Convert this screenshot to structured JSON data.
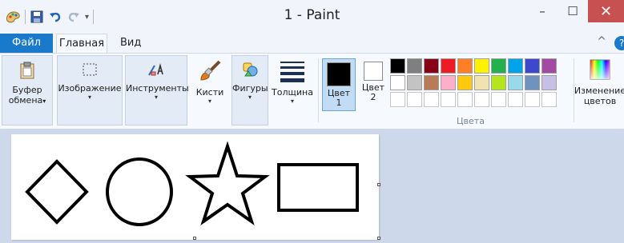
{
  "window": {
    "title": "1 - Paint",
    "minimize": "–",
    "maximize": "☐",
    "close": "✕"
  },
  "tabs": {
    "file": "Файл",
    "home": "Главная",
    "view": "Вид",
    "collapse": "^",
    "help": "?"
  },
  "ribbon": {
    "clipboard": {
      "line1": "Буфер",
      "line2": "обмена",
      "arrow": "▾"
    },
    "image": {
      "label": "Изображение",
      "arrow": "▾"
    },
    "tools": {
      "label": "Инструменты",
      "arrow": "▾"
    },
    "brushes": {
      "label": "Кисти",
      "arrow": "▾"
    },
    "shapes": {
      "label": "Фигуры",
      "arrow": "▾"
    },
    "thickness": {
      "label": "Толщина",
      "arrow": "▾"
    },
    "color1": {
      "line1": "Цвет",
      "line2": "1",
      "color": "#000000"
    },
    "color2": {
      "line1": "Цвет",
      "line2": "2",
      "color": "#ffffff"
    },
    "edit_colors": {
      "line1": "Изменение",
      "line2": "цветов"
    },
    "colors_group_label": "Цвета"
  },
  "palette": {
    "row1": [
      "#000000",
      "#7f7f7f",
      "#880015",
      "#ed1c24",
      "#ff7f27",
      "#fff200",
      "#22b14c",
      "#00a2e8",
      "#3f48cc",
      "#a349a4"
    ],
    "row2": [
      "#ffffff",
      "#c3c3c3",
      "#b97a57",
      "#ffaec9",
      "#ffc90e",
      "#efe4b0",
      "#b5e61d",
      "#99d9ea",
      "#7092be",
      "#c8bfe7"
    ],
    "empty_slots": 10
  },
  "canvas": {
    "shapes": [
      "diamond",
      "circle",
      "star",
      "rectangle"
    ]
  }
}
